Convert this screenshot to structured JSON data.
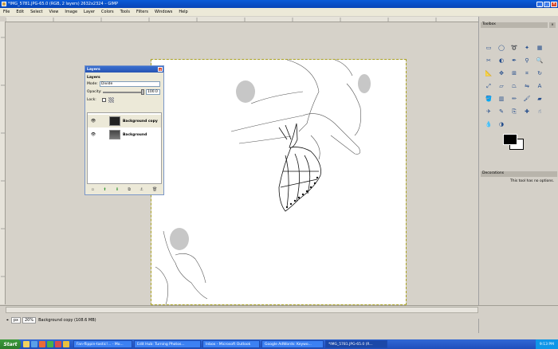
{
  "window": {
    "title": "*IMG_5781.JPG-65.0 (RGB, 2 layers) 2632x2324 – GIMP"
  },
  "menu": [
    "File",
    "Edit",
    "Select",
    "View",
    "Image",
    "Layer",
    "Colors",
    "Tools",
    "Filters",
    "Windows",
    "Help"
  ],
  "layers_dialog": {
    "title": "Layers",
    "section": "Layers",
    "mode_label": "Mode:",
    "mode_value": "Divide",
    "opacity_label": "Opacity:",
    "opacity_value": "100.0",
    "lock_label": "Lock:",
    "layers": [
      {
        "name": "Background copy",
        "active": true
      },
      {
        "name": "Background",
        "active": false
      }
    ]
  },
  "toolbox": {
    "title": "Toolbox",
    "dock_title": "Decorations",
    "no_options": "This tool has no options."
  },
  "status": {
    "unit": "px",
    "zoom": "20%",
    "layer_info": "Background copy (108.6 MB)"
  },
  "taskbar": {
    "start": "Start",
    "tasks": [
      "Fan-flippin-tastic!... - Mo...",
      "Edit Hub: Turning Photos...",
      "Inbox - Microsoft Outlook",
      "Google AdWords: Keywo...",
      "*IMG_5781.JPG-65.0 (R..."
    ],
    "time": "9:13 PM"
  },
  "colors": {
    "fg": "#000000",
    "bg": "#ffffff"
  }
}
